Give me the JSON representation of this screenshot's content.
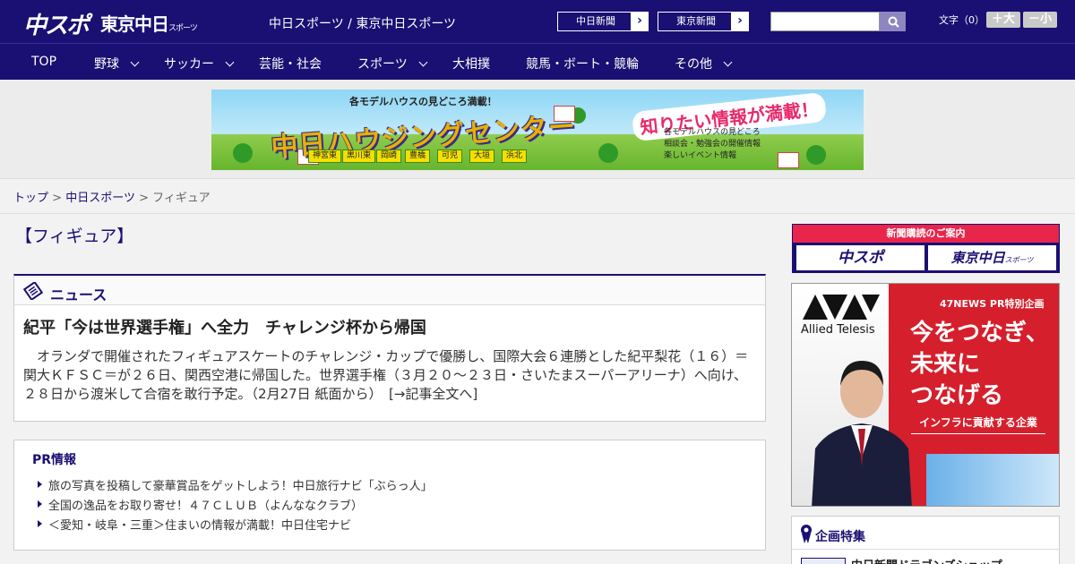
{
  "header": {
    "logo_main": "中スポ",
    "logo_tokyo": "東京中日",
    "logo_tokyo_sub": "スポーツ",
    "site_names": "中日スポーツ / 東京中日スポーツ",
    "ext_links": [
      {
        "label": "中日新聞",
        "arrow": "›"
      },
      {
        "label": "東京新聞",
        "arrow": "›"
      }
    ],
    "search_placeholder": "",
    "font_label": "文字（0）",
    "font_bigger": "＋大",
    "font_smaller": "－小"
  },
  "nav": {
    "items": [
      {
        "label": "TOP",
        "dropdown": false
      },
      {
        "label": "野球",
        "dropdown": true
      },
      {
        "label": "サッカー",
        "dropdown": true
      },
      {
        "label": "芸能・社会",
        "dropdown": false
      },
      {
        "label": "スポーツ",
        "dropdown": true
      },
      {
        "label": "大相撲",
        "dropdown": false
      },
      {
        "label": "競馬・ボート・競輪",
        "dropdown": false
      },
      {
        "label": "その他",
        "dropdown": true
      }
    ]
  },
  "banner": {
    "top_text": "各モデルハウスの見どころ満載！",
    "main_text": "中日ハウジングセンター",
    "right_text": "知りたい情報が満載！",
    "list": [
      "各モデルハウスの見どころ",
      "相談会・勉強会の開催情報",
      "楽しいイベント情報"
    ],
    "cities": [
      "神宮東",
      "黒川東",
      "岡崎",
      "豊橋",
      "可児",
      "大垣",
      "浜北"
    ]
  },
  "breadcrumb": {
    "items": [
      "トップ",
      "中日スポーツ"
    ],
    "separator": ">",
    "current": "フィギュア"
  },
  "main": {
    "page_title": "【フィギュア】",
    "news": {
      "section_label": "ニュース",
      "title": "紀平「今は世界選手権」へ全力　チャレンジ杯から帰国",
      "body": "オランダで開催されたフィギュアスケートのチャレンジ・カップで優勝し、国際大会６連勝とした紀平梨花（１６）＝関大ＫＦＳＣ＝が２６日、関西空港に帰国した。世界選手権（３月２０～２３日・さいたまスーパーアリーナ）へ向け、２８日から渡米して合宿を敢行予定。（2月27日 紙面から）　[→記事全文へ]"
    },
    "pr": {
      "title": "PR情報",
      "items": [
        "旅の写真を投稿して豪華賞品をゲットしよう！中日旅行ナビ「ぶらっ人」",
        "全国の逸品をお取り寄せ！４７ＣＬＵＢ（よんななクラブ）",
        "＜愛知・岐阜・三重＞住まいの情報が満載！中日住宅ナビ"
      ]
    }
  },
  "sidebar": {
    "subscribe": {
      "heading": "新聞購読のご案内",
      "logos": [
        "中スポ",
        "東京中日"
      ],
      "logo_sub": "スポーツ"
    },
    "ad": {
      "brand": "Allied Telesis",
      "pr_label": "47NEWS PR特別企画",
      "copy": [
        "今をつなぎ、",
        "未来に",
        "つなげる"
      ],
      "tagline": "インフラに貢献する企業"
    },
    "feature": {
      "heading": "企画特集",
      "item": "中日新聞ドラゴンズショップ"
    }
  },
  "colors": {
    "brand_navy": "#1a0f72",
    "accent_red": "#e8254a",
    "ad_red": "#d61f2c"
  }
}
